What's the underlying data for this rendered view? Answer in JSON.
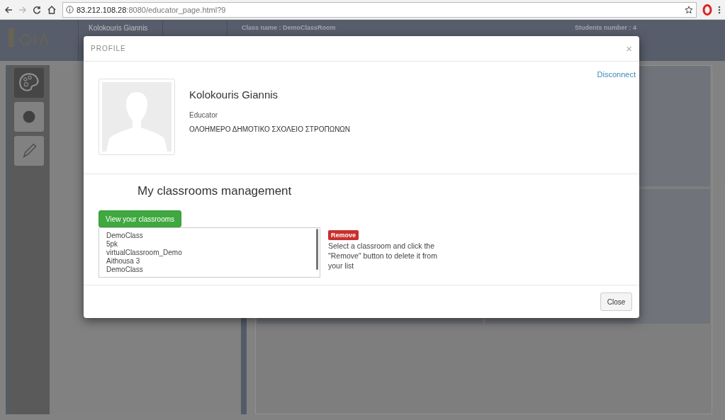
{
  "browser": {
    "url_host": "83.212.108.28",
    "url_rest": ":8080/educator_page.html?9"
  },
  "app_header": {
    "user": "Kolokouris Giannis",
    "class_name": "Class name : DemoClassRoom",
    "students": "Students number : 4"
  },
  "modal": {
    "title": "PROFILE",
    "close_glyph": "×",
    "disconnect": "Disconnect",
    "name": "Kolokouris Giannis",
    "role": "Educator",
    "school": "ΟΛΟΗΜΕΡΟ ΔΗΜΟΤΙΚΟ ΣΧΟΛΕΙΟ ΣΤΡΟΠΩΝΩΝ",
    "section_title": "My classrooms management",
    "view_button": "View your classrooms",
    "classrooms": [
      "DemoClass",
      "5pk",
      "virtualClassroom_Demo",
      "Aithousa 3",
      "DemoClass"
    ],
    "remove_button": "Remove",
    "help": "Select a classroom and click the \"Remove\" button to delete it from your list",
    "footer_button": "Close"
  }
}
